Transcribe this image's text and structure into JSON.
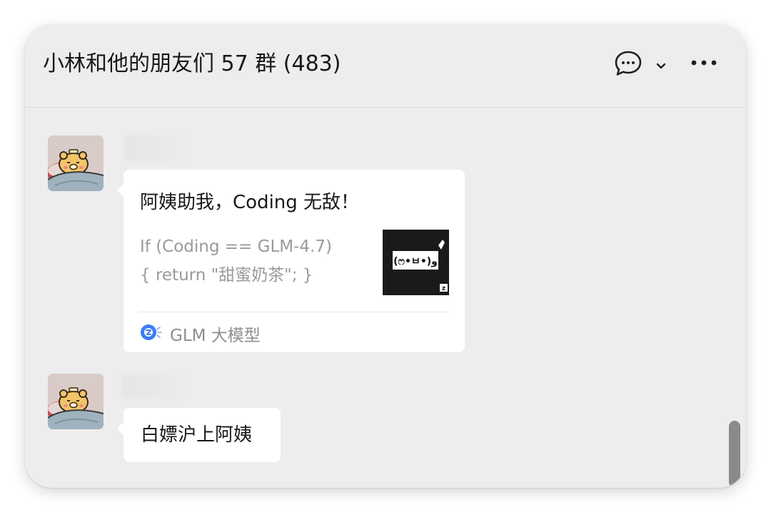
{
  "header": {
    "title": "小林和他的朋友们 57 群 (483)",
    "chat_icon": "speech-bubble-icon",
    "dropdown_icon": "chevron-down-icon",
    "more_icon": "more-horizontal-icon"
  },
  "messages": [
    {
      "type": "link-card",
      "avatar_icon": "bear-avatar",
      "card": {
        "title": "阿姨助我，Coding 无敌！",
        "description": "If (Coding == GLM-4.7)\n{ return \"甜蜜奶茶\"; }",
        "thumbnail_text": "(ෆ•ㅂ•)و",
        "thumbnail_badge": "z",
        "source_icon": "glm-logo-icon",
        "source_label": "GLM 大模型"
      }
    },
    {
      "type": "text",
      "avatar_icon": "bear-avatar",
      "text": "白嫖沪上阿姨"
    }
  ],
  "colors": {
    "window_bg": "#ededed",
    "bubble_bg": "#ffffff",
    "title_text": "#181818",
    "secondary_text": "#9a9a9a",
    "accent_blue": "#3d7bf5"
  }
}
